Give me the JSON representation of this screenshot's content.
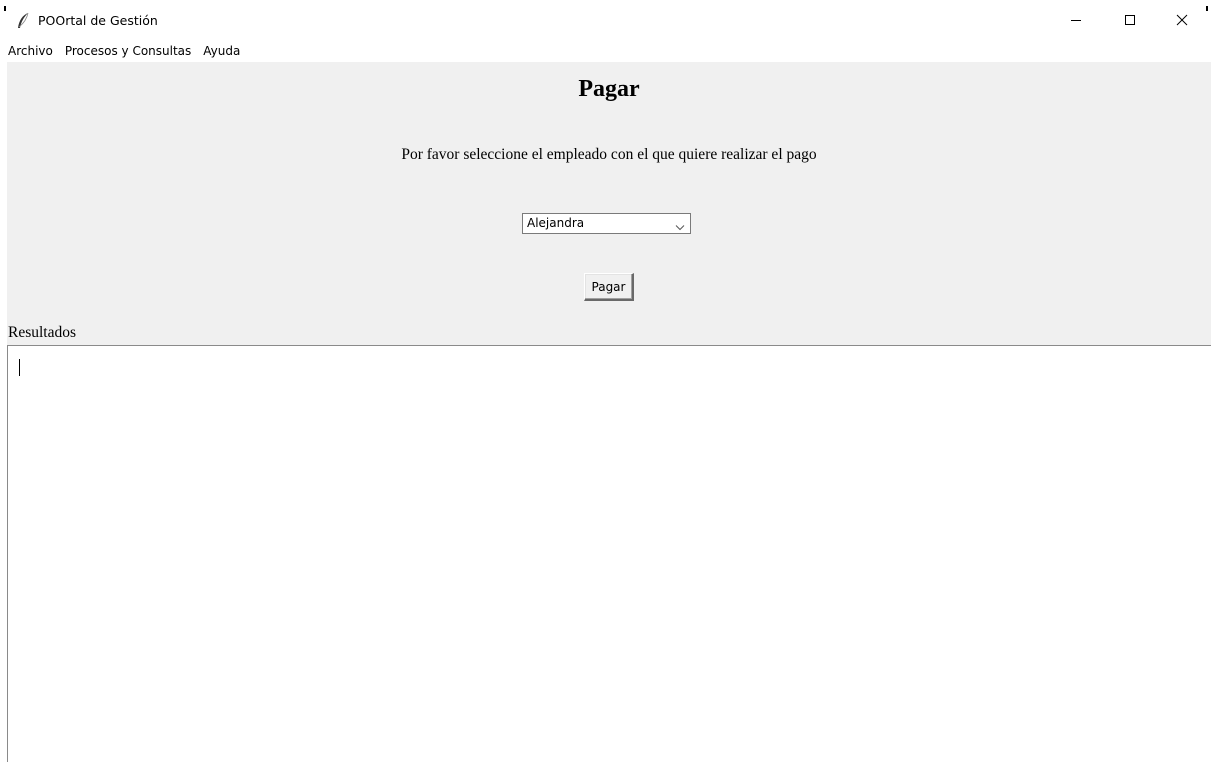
{
  "window": {
    "title": "POOrtal de Gestión",
    "icon": "feather-icon",
    "controls": [
      "minimize-icon",
      "maximize-icon",
      "close-icon"
    ]
  },
  "menubar": {
    "items": [
      {
        "label": "Archivo"
      },
      {
        "label": "Procesos y Consultas"
      },
      {
        "label": "Ayuda"
      }
    ]
  },
  "main": {
    "title": "Pagar",
    "instruction": "Por favor seleccione el empleado con el que quiere realizar el pago",
    "employee_select": {
      "selected": "Alejandra",
      "icon": "chevron-down-icon"
    },
    "pay_button_label": "Pagar",
    "results_label": "Resultados",
    "results_text": ""
  },
  "colors": {
    "panel_bg": "#f0f0f0",
    "window_bg": "#ffffff",
    "border": "#8a8a8a"
  }
}
